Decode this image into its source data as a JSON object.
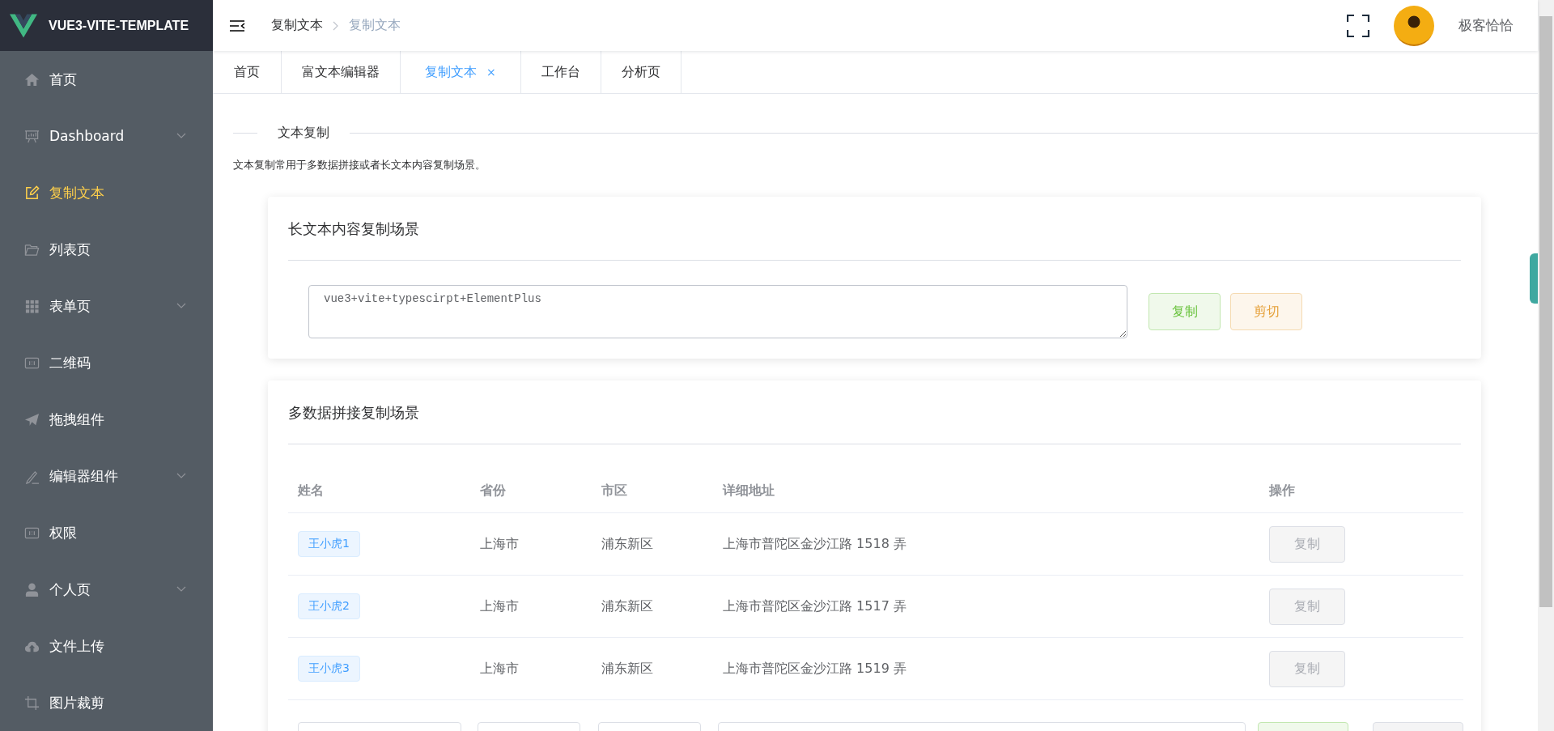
{
  "logo": {
    "title": "VUE3-VITE-TEMPLATE"
  },
  "sidebar": {
    "items": [
      {
        "label": "首页",
        "kind": "home",
        "selected": false,
        "has_submenu": false
      },
      {
        "label": "Dashboard",
        "kind": "presentation",
        "selected": false,
        "has_submenu": true
      },
      {
        "label": "复制文本",
        "kind": "edit",
        "selected": true,
        "has_submenu": false
      },
      {
        "label": "列表页",
        "kind": "folder",
        "selected": false,
        "has_submenu": false
      },
      {
        "label": "表单页",
        "kind": "grid",
        "selected": false,
        "has_submenu": true
      },
      {
        "label": "二维码",
        "kind": "box",
        "selected": false,
        "has_submenu": false
      },
      {
        "label": "拖拽组件",
        "kind": "plane",
        "selected": false,
        "has_submenu": false
      },
      {
        "label": "编辑器组件",
        "kind": "pencil",
        "selected": false,
        "has_submenu": true
      },
      {
        "label": "权限",
        "kind": "box",
        "selected": false,
        "has_submenu": false
      },
      {
        "label": "个人页",
        "kind": "user",
        "selected": false,
        "has_submenu": true
      },
      {
        "label": "文件上传",
        "kind": "cloud",
        "selected": false,
        "has_submenu": false
      },
      {
        "label": "图片裁剪",
        "kind": "crop",
        "selected": false,
        "has_submenu": false
      }
    ]
  },
  "header": {
    "breadcrumb": [
      "复制文本",
      "复制文本"
    ],
    "user_name": "极客恰恰"
  },
  "tabs": [
    {
      "label": "首页",
      "selected": false
    },
    {
      "label": "富文本编辑器",
      "selected": false
    },
    {
      "label": "复制文本",
      "selected": true,
      "close": "×"
    },
    {
      "label": "工作台",
      "selected": false
    },
    {
      "label": "分析页",
      "selected": false
    }
  ],
  "section": {
    "title": "文本复制",
    "description": "文本复制常用于多数据拼接或者长文本内容复制场景。"
  },
  "long_text_card": {
    "title": "长文本内容复制场景",
    "textarea_value": "vue3+vite+typescirpt+ElementPlus",
    "buttons": [
      {
        "label": "复制",
        "kind": "success"
      },
      {
        "label": "剪切",
        "kind": "warning"
      }
    ]
  },
  "table_card": {
    "title": "多数据拼接复制场景",
    "columns": [
      "姓名",
      "省份",
      "市区",
      "详细地址",
      "操作"
    ],
    "rows": [
      {
        "name": "王小虎1",
        "province": "上海市",
        "city": "浦东新区",
        "address": "上海市普陀区金沙江路 1518 弄",
        "action": "复制"
      },
      {
        "name": "王小虎2",
        "province": "上海市",
        "city": "浦东新区",
        "address": "上海市普陀区金沙江路 1517 弄",
        "action": "复制"
      },
      {
        "name": "王小虎3",
        "province": "上海市",
        "city": "浦东新区",
        "address": "上海市普陀区金沙江路 1519 弄",
        "action": "复制"
      }
    ]
  }
}
